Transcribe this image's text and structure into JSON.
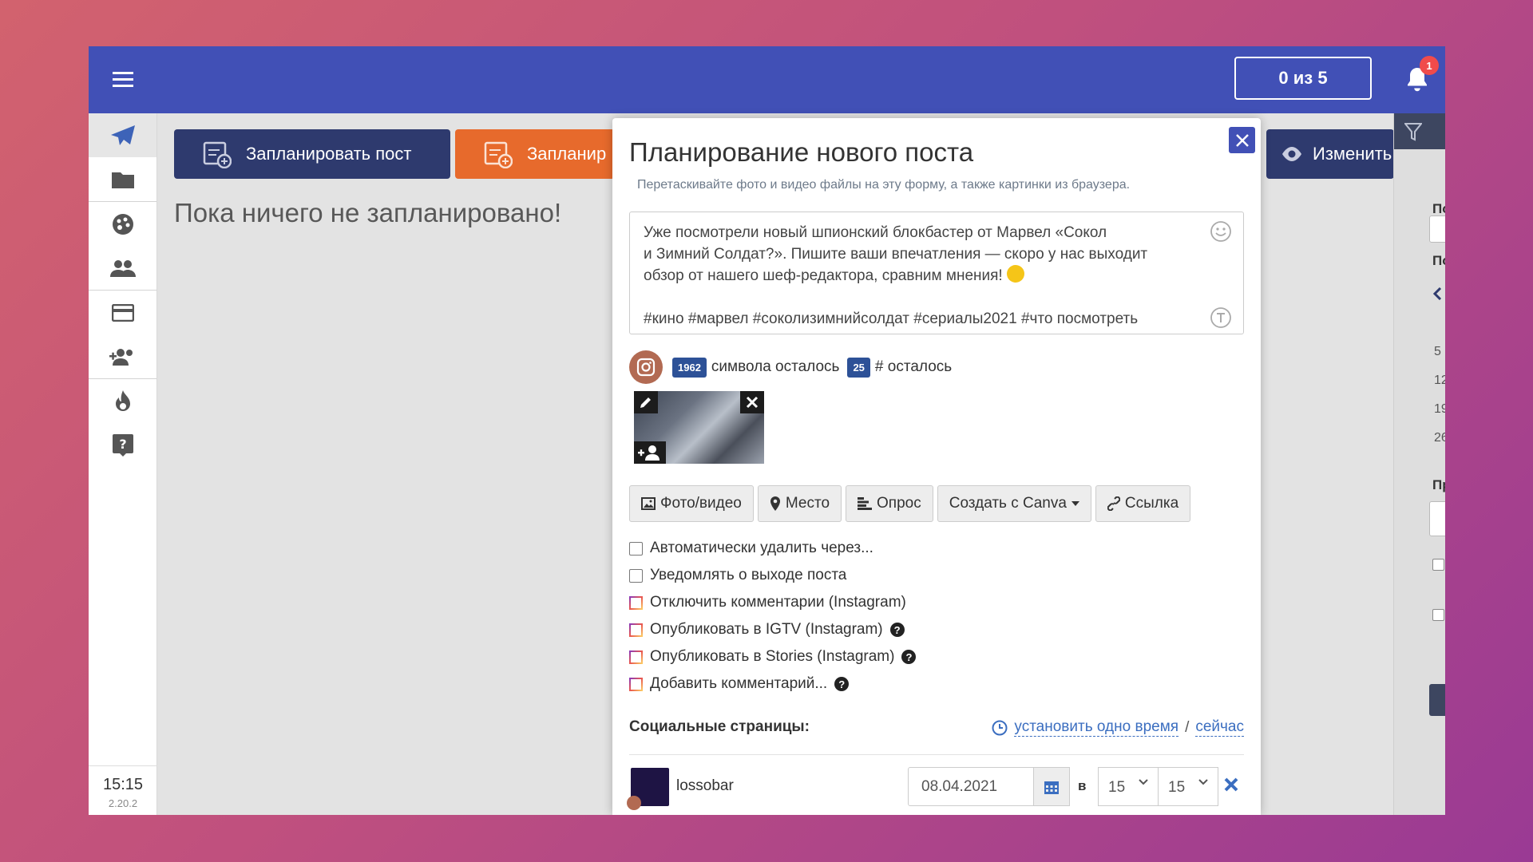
{
  "header": {
    "counter_label": "0 из 5",
    "notification_count": "1"
  },
  "sidebar": {
    "items": [
      "send-icon",
      "folder-icon",
      "palette-icon",
      "users-icon",
      "card-icon",
      "add-users-icon",
      "fire-icon",
      "help-icon"
    ],
    "time": "15:15",
    "version": "2.20.2"
  },
  "background": {
    "schedule_post_label": "Запланировать пост",
    "schedule_other_label": "Запланир",
    "edit_label": "Изменить",
    "empty_message": "Пока ничего не запланировано!",
    "right_panel": {
      "label1": "По",
      "label2": "По",
      "label3": "Пр",
      "nums": [
        "5",
        "12",
        "19",
        "26"
      ]
    }
  },
  "modal": {
    "title": "Планирование нового поста",
    "hint": "Перетаскивайте фото и видео файлы на эту форму, а также картинки из браузера.",
    "post_text": {
      "line1": "Уже посмотрели новый шпионский блокбастер от Марвел «Сокол",
      "line2": "и Зимний Солдат?». Пишите ваши впечатления — скоро у нас выходит",
      "line3": "обзор от нашего шеф-редактора, сравним мнения!",
      "hashtags": "#кино #марвел #соколизимнийсолдат #сериалы2021 #что посмотреть"
    },
    "chars_left": "1962",
    "chars_left_label": "символа осталось",
    "hashtags_left": "25",
    "hashtags_left_label": "# осталось",
    "buttons": {
      "photo_video": "Фото/видео",
      "place": "Место",
      "poll": "Опрос",
      "canva": "Создать с Canva",
      "link": "Ссылка"
    },
    "options": [
      {
        "label": "Автоматически удалить через...",
        "instagram": false,
        "help": false
      },
      {
        "label": "Уведомлять о выходе поста",
        "instagram": false,
        "help": false
      },
      {
        "label": "Отключить комментарии (Instagram)",
        "instagram": true,
        "help": false
      },
      {
        "label": "Опубликовать в IGTV (Instagram)",
        "instagram": true,
        "help": true
      },
      {
        "label": "Опубликовать в Stories (Instagram)",
        "instagram": true,
        "help": true
      },
      {
        "label": "Добавить комментарий...",
        "instagram": true,
        "help": true
      }
    ],
    "social": {
      "header": "Социальные страницы:",
      "set_time_link": "установить одно время",
      "separator": "/",
      "now_link": "сейчас"
    },
    "account": {
      "name": "lossobar",
      "date": "08.04.2021",
      "at_label": "в",
      "hour": "15",
      "minute": "15"
    }
  },
  "colors": {
    "header": "#4150b6",
    "accent_dark": "#2e3a6e",
    "badge": "#2d5197",
    "link": "#3b6ec0"
  }
}
